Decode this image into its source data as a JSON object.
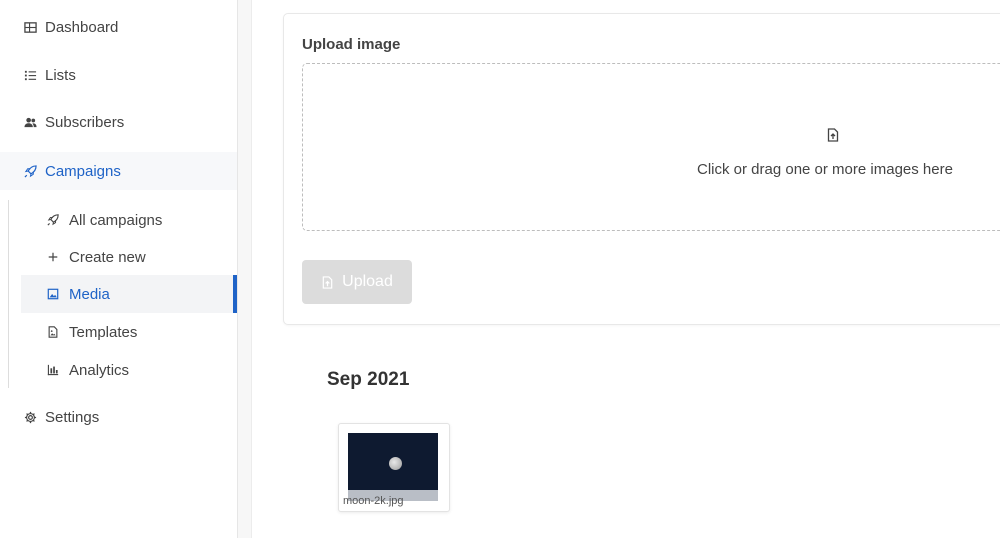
{
  "sidebar": {
    "items": [
      {
        "label": "Dashboard",
        "icon": "dashboard-icon"
      },
      {
        "label": "Lists",
        "icon": "list-icon"
      },
      {
        "label": "Subscribers",
        "icon": "users-icon"
      },
      {
        "label": "Campaigns",
        "icon": "rocket-icon"
      },
      {
        "label": "Settings",
        "icon": "gear-icon"
      }
    ],
    "campaign_subitems": [
      {
        "label": "All campaigns",
        "icon": "rocket-icon"
      },
      {
        "label": "Create new",
        "icon": "plus-icon"
      },
      {
        "label": "Media",
        "icon": "image-icon"
      },
      {
        "label": "Templates",
        "icon": "file-image-icon"
      },
      {
        "label": "Analytics",
        "icon": "chart-icon"
      }
    ],
    "active_item": "Campaigns",
    "active_subitem": "Media"
  },
  "upload": {
    "label": "Upload image",
    "dropzone_text": "Click or drag one or more images here",
    "button_label": "Upload"
  },
  "media": {
    "groups": [
      {
        "title": "Sep 2021",
        "files": [
          {
            "name": "moon-2k.jpg"
          }
        ]
      }
    ]
  },
  "colors": {
    "accent": "#1f63c7",
    "button_disabled": "#dcdcdc"
  }
}
